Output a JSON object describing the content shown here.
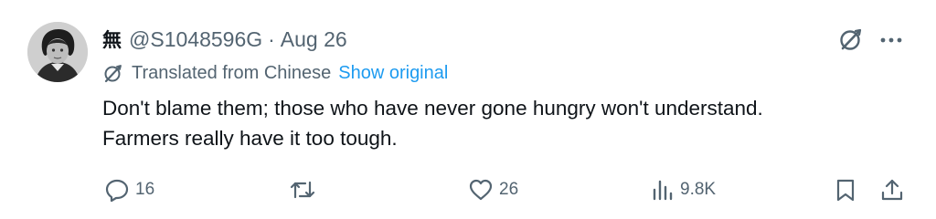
{
  "tweet": {
    "author": {
      "display_name": "無",
      "handle": "@S1048596G",
      "separator": "·",
      "date": "Aug 26"
    },
    "translation": {
      "label": "Translated from Chinese",
      "show_original_label": "Show original"
    },
    "text_lines": [
      "Don't blame them; those who have never gone hungry won't understand.",
      "Farmers really have it too tough."
    ],
    "actions": {
      "reply_count": "16",
      "retweet_count": "",
      "like_count": "26",
      "view_count": "9.8K"
    },
    "icons": {
      "avatar": "profile-photo",
      "header_right": [
        "grok-icon",
        "more-icon"
      ],
      "translation": "translate-icon",
      "actions": [
        "reply-icon",
        "retweet-icon",
        "like-icon",
        "views-icon",
        "bookmark-icon",
        "share-icon"
      ]
    },
    "colors": {
      "text": "#0f1419",
      "secondary": "#536471",
      "link": "#1d9bf0",
      "background": "#ffffff"
    }
  }
}
